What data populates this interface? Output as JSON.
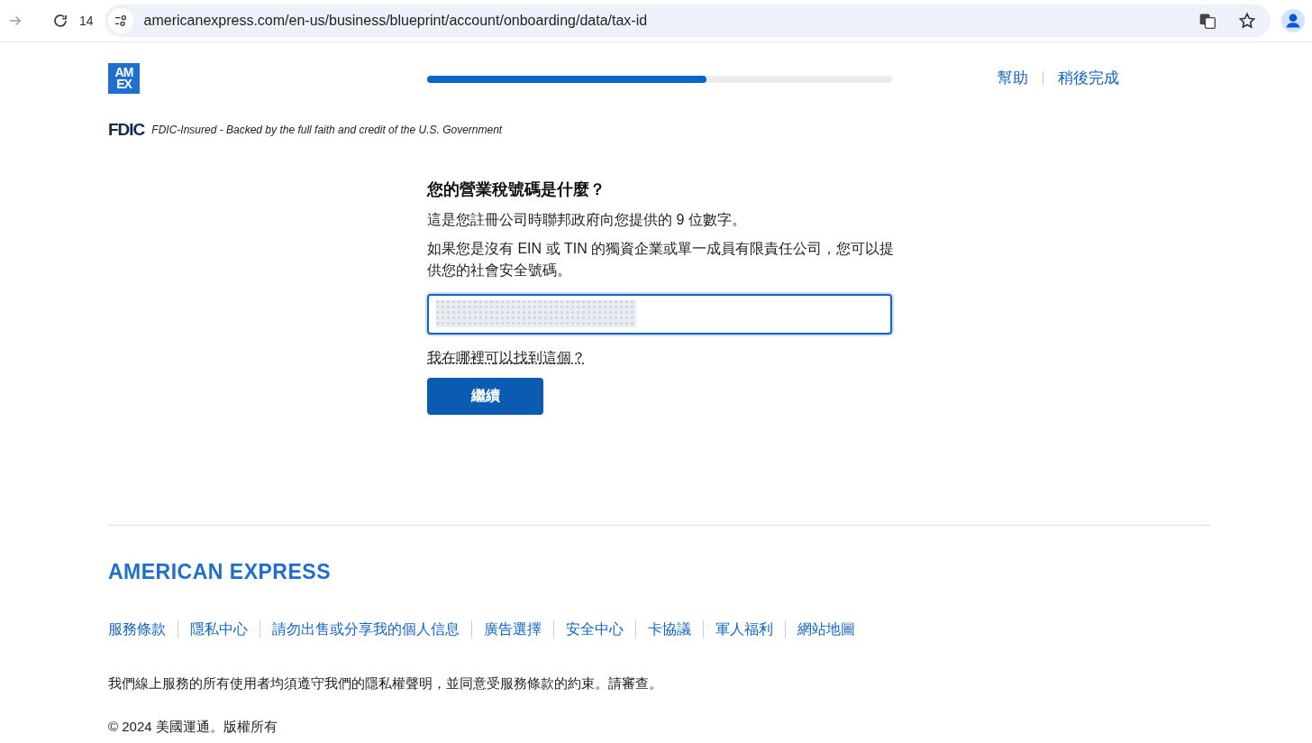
{
  "browser": {
    "tab_count": "14",
    "url": "americanexpress.com/en-us/business/blueprint/account/onboarding/data/tax-id"
  },
  "header": {
    "logo": [
      "AM",
      "EX"
    ],
    "progress": {
      "level": 0.6
    },
    "links": [
      "幫助",
      "稍後完成"
    ]
  },
  "fdic": {
    "mark": "FDIC",
    "text": "FDIC-Insured - Backed by the full faith and credit of the U.S. Government"
  },
  "form": {
    "title": "您的營業稅號碼是什麼？",
    "paragraphs": [
      "這是您註冊公司時聯邦政府向您提供的 9 位數字。",
      "如果您是沒有 EIN 或 TIN 的獨資企業或單一成員有限責任公司，您可以提供您的社會安全號碼。"
    ],
    "field": {
      "focused": true,
      "redacted": true
    },
    "help_link": "我在哪裡可以找到這個？",
    "button": "繼續"
  },
  "footer": {
    "brand": "AMERICAN EXPRESS",
    "links": [
      "服務條款",
      "隱私中心",
      "請勿出售或分享我的個人信息",
      "廣告選擇",
      "安全中心",
      "卡協議",
      "軍人福利",
      "網站地圖"
    ],
    "notice": "我們線上服務的所有使用者均須遵守我們的隱私權聲明，並同意受服務條款的約束。請審查。",
    "copyright": "© 2024 美國運通。版權所有"
  }
}
